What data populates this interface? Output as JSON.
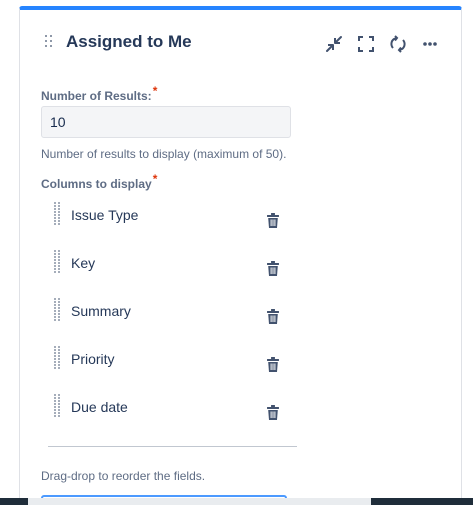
{
  "gadget": {
    "title": "Assigned to Me",
    "icons": {
      "drag": "drag-handle-icon",
      "minimize": "minimize-icon",
      "fullscreen": "fullscreen-icon",
      "refresh": "refresh-icon",
      "more": "more-icon"
    },
    "colors": {
      "accent": "#2684ff",
      "required": "#de350b",
      "focus": "#4c9aff"
    }
  },
  "form": {
    "results_label": "Number of Results:",
    "required_mark": "*",
    "results_value": "10",
    "results_help": "Number of results to display (maximum of 50).",
    "columns_label": "Columns to display",
    "columns": [
      {
        "label": "Issue Type"
      },
      {
        "label": "Key"
      },
      {
        "label": "Summary"
      },
      {
        "label": "Priority"
      },
      {
        "label": "Due date"
      }
    ],
    "reorder_help": "Drag-drop to reorder the fields."
  }
}
